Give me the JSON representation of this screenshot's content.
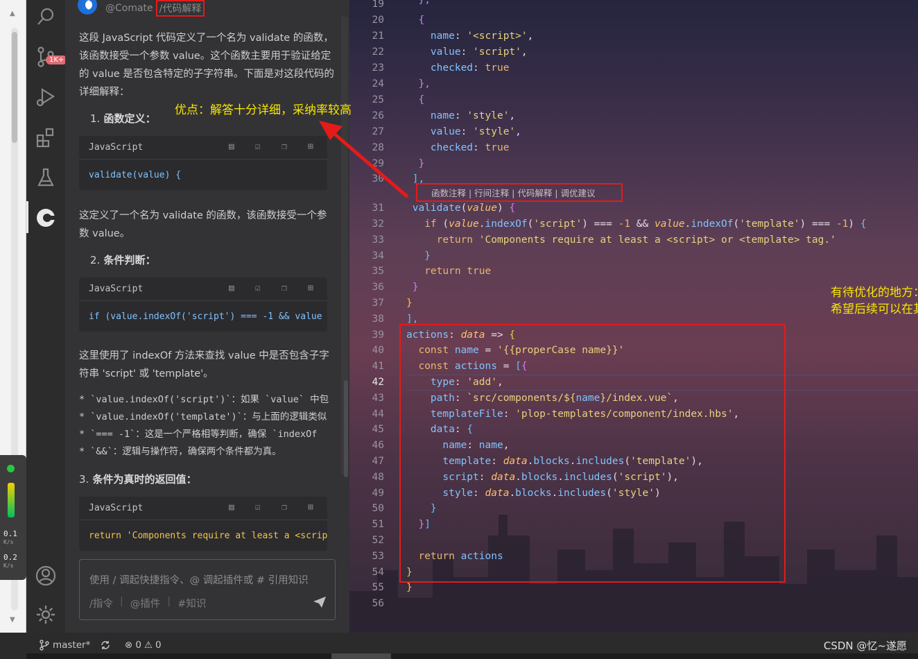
{
  "net_widget": {
    "up_speed": "0.1",
    "up_unit": "K/s",
    "down_speed": "0.2",
    "down_unit": "K/s"
  },
  "activity_bar": {
    "source_control_badge": "1K+"
  },
  "chat": {
    "user": "@Comate",
    "command": "/代码解释",
    "intro": "这段 JavaScript 代码定义了一个名为 validate 的函数，该函数接受一个参数 value。这个函数主要用于验证给定的 value 是否包含特定的子字符串。下面是对这段代码的详细解释：",
    "step1_num": "1.",
    "step1_title": "函数定义",
    "card1_lang": "JavaScript",
    "card1_code": "validate(value) {",
    "para2": "这定义了一个名为 validate 的函数，该函数接受一个参数 value。",
    "step2_num": "2.",
    "step2_title": "条件判断",
    "card2_lang": "JavaScript",
    "card2_code": "if (value.indexOf('script') === -1 && value",
    "para3": "这里使用了 indexOf 方法来查找 value 中是否包含子字符串 'script' 或 'template'。",
    "bullets": [
      "* `value.indexOf('script')`：如果 `value` 中包",
      "* `value.indexOf('template')`：与上面的逻辑类似",
      "* `=== -1`：这是一个严格相等判断，确保 `indexOf",
      "* `&&`：逻辑与操作符，确保两个条件都为真。"
    ],
    "step3_num": "3.",
    "step3_title": "条件为真时的返回值",
    "card3_lang": "JavaScript",
    "card3_code": "return 'Components require at least a <script",
    "input_placeholder": "使用 / 调起快捷指令、@ 调起插件或 # 引用知识",
    "chip_cmd": "/指令",
    "chip_plugin": "@插件",
    "chip_knowledge": "#知识"
  },
  "editor": {
    "codelens": "函数注释 | 行间注释 | 代码解释 | 调优建议",
    "note_top": "优点：解答十分详细，采纳率较高",
    "note_mid_1": "有待优化的地方：目前编程提示，主要作用于方法上，",
    "note_mid_2": "希望后续可以在其它形式的编码上也出现提示，减少额外的时间开销",
    "current_line": "42",
    "line_numbers": [
      "19",
      "20",
      "21",
      "22",
      "23",
      "24",
      "25",
      "26",
      "27",
      "28",
      "29",
      "30",
      "31",
      "32",
      "33",
      "34",
      "35",
      "36",
      "37",
      "38",
      "39",
      "40",
      "41",
      "42",
      "43",
      "44",
      "45",
      "46",
      "47",
      "48",
      "49",
      "50",
      "51",
      "52",
      "53",
      "54",
      "55",
      "56"
    ]
  },
  "status_bar": {
    "branch": "master*",
    "errors": "0",
    "warnings": "0",
    "watermark": "CSDN @忆~遂愿"
  }
}
